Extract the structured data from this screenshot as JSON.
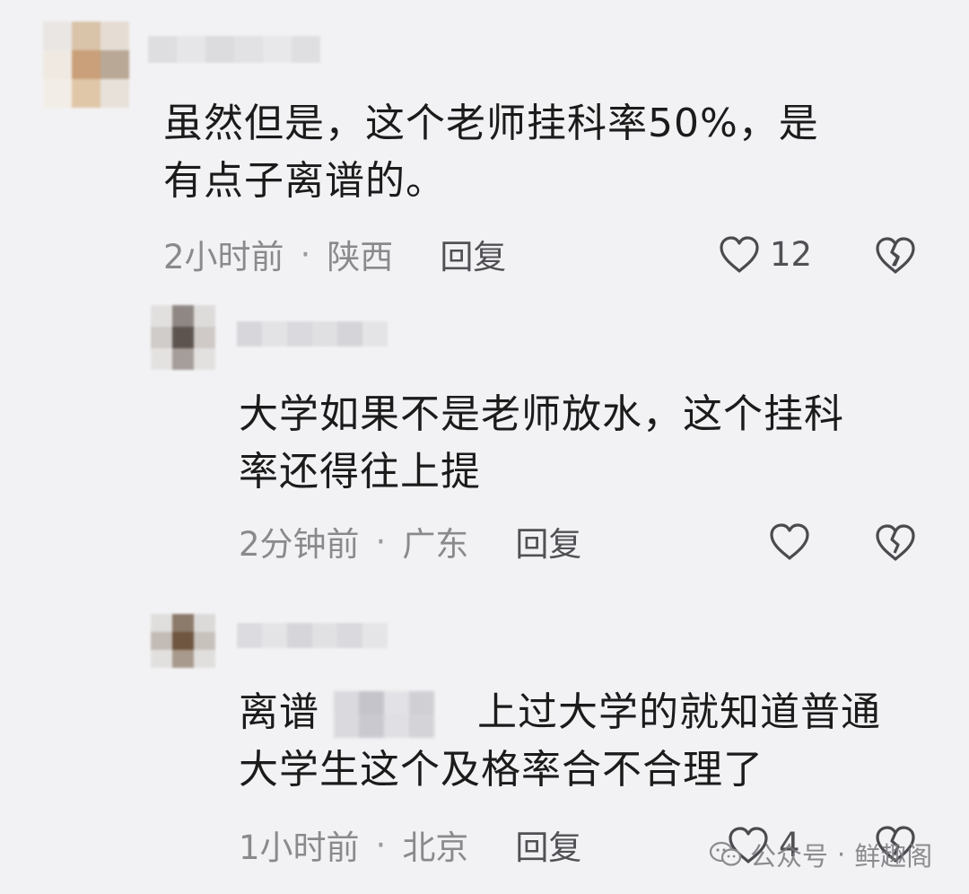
{
  "comments": [
    {
      "text_line1": "虽然但是，这个老师挂科率50%，是",
      "text_line2": "有点子离谱的。",
      "time": "2小时前",
      "separator": "·",
      "location": "陕西",
      "reply_label": "回复",
      "like_count": "12",
      "avatar_colors": [
        "#e9e6e3",
        "#d9c3a9",
        "#e5ddd3",
        "#efe9e2",
        "#c9a07a",
        "#b9a896",
        "#f2ede6",
        "#e0c7a8",
        "#e7e1da"
      ],
      "name_colors": [
        "#dedee1",
        "#e6e6e9",
        "#dcdcdf",
        "#e2e2e5",
        "#e8e8eb",
        "#dfdfe2"
      ]
    },
    {
      "text_line1": "大学如果不是老师放水，这个挂科",
      "text_line2": "率还得往上提",
      "time": "2分钟前",
      "separator": "·",
      "location": "广东",
      "reply_label": "回复",
      "like_count": "",
      "avatar_colors": [
        "#e2e0df",
        "#8f8783",
        "#dedcdb",
        "#d0ccca",
        "#5d534f",
        "#cfcac7",
        "#e4e2e1",
        "#a59d99",
        "#e3e1e0"
      ],
      "name_colors": [
        "#d7d7db",
        "#e3e3e6",
        "#dadade",
        "#e0e0e3",
        "#d5d5d9",
        "#e4e4e7"
      ]
    },
    {
      "text_line1_a": "离谱",
      "text_line1_b": "上过大学的就知道普通",
      "text_line2": "大学生这个及格率合不合理了",
      "time": "1小时前",
      "separator": "·",
      "location": "北京",
      "reply_label": "回复",
      "like_count": "4",
      "avatar_colors": [
        "#e0dedd",
        "#8c7a6a",
        "#dcdad9",
        "#c3bcb6",
        "#6e5640",
        "#c8c2bc",
        "#e2e0df",
        "#a89a8c",
        "#e1dfde"
      ],
      "name_colors": [
        "#dcdce0",
        "#e4e4e7",
        "#d6d6da",
        "#e1e1e4",
        "#dadade",
        "#e5e5e8"
      ],
      "censor_colors": [
        "#d9d9de",
        "#c4c4ca",
        "#e2e2e6",
        "#cfcfd4",
        "#dadade",
        "#c9c9cf",
        "#e0e0e4",
        "#d3d3d8"
      ]
    }
  ],
  "watermark": {
    "prefix": "公众号",
    "separator": "·",
    "name": "鲜趣阁"
  },
  "icons": {
    "like": "heart-outline-icon",
    "dislike": "broken-heart-icon",
    "watermark": "wechat-icon"
  }
}
